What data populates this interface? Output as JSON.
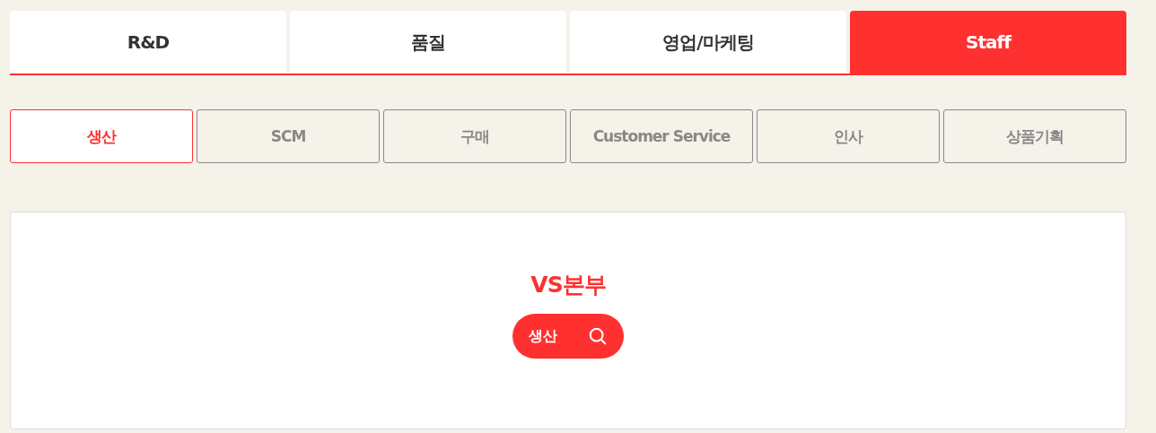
{
  "main_tabs": [
    {
      "label": "R&D",
      "selected": false
    },
    {
      "label": "품질",
      "selected": false
    },
    {
      "label": "영업/마케팅",
      "selected": false
    },
    {
      "label": "Staff",
      "selected": true
    }
  ],
  "sub_tabs": [
    {
      "label": "생산",
      "selected": true
    },
    {
      "label": "SCM",
      "selected": false
    },
    {
      "label": "구매",
      "selected": false
    },
    {
      "label": "Customer Service",
      "selected": false
    },
    {
      "label": "인사",
      "selected": false
    },
    {
      "label": "상품기획",
      "selected": false
    }
  ],
  "card": {
    "title": "VS본부",
    "search_button": {
      "label": "생산"
    }
  }
}
